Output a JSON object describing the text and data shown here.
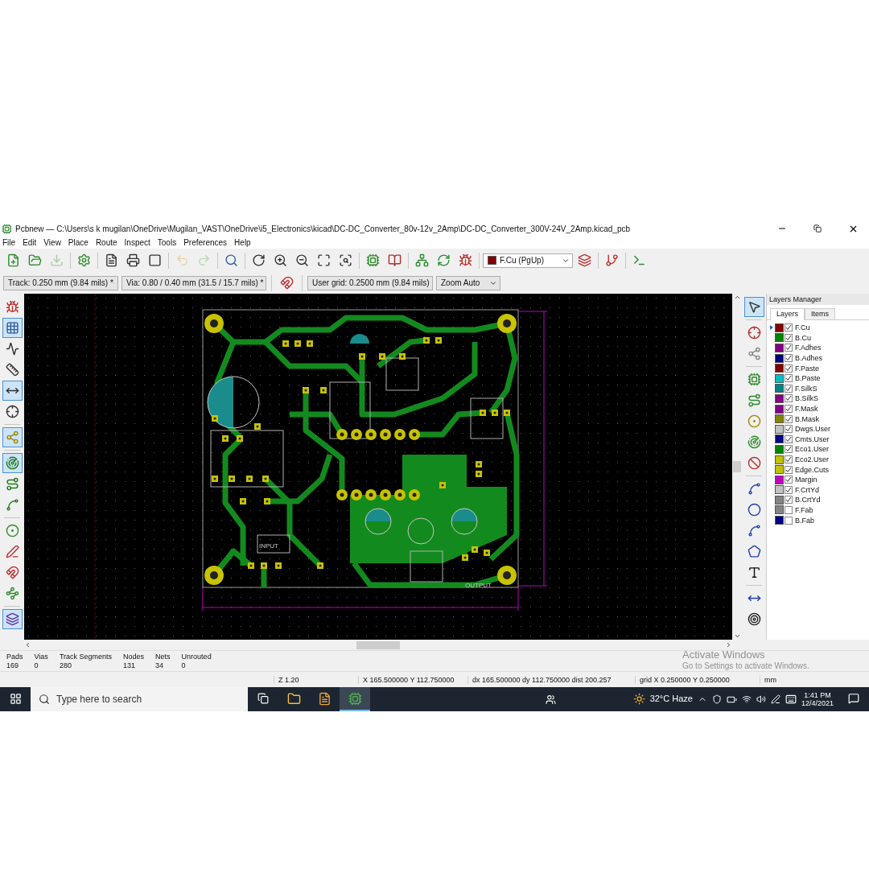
{
  "window": {
    "title": "Pcbnew — C:\\Users\\s k mugilan\\OneDrive\\Mugilan_VAST\\OneDrive\\i5_Electronics\\kicad\\DC-DC_Converter_80v-12v_2Amp\\DC-DC_Converter_300V-24V_2Amp.kicad_pcb"
  },
  "menu": [
    "File",
    "Edit",
    "View",
    "Place",
    "Route",
    "Inspect",
    "Tools",
    "Preferences",
    "Help"
  ],
  "main_toolbar": {
    "tools": [
      {
        "disabled": false
      },
      {
        "disabled": false
      },
      {
        "disabled": true
      },
      {
        "disabled": false
      },
      {
        "disabled": false
      },
      {
        "disabled": false
      },
      {
        "disabled": false
      },
      {
        "disabled": true
      },
      {
        "disabled": true
      },
      {
        "disabled": false
      },
      {
        "disabled": false
      },
      {
        "disabled": false
      },
      {
        "disabled": false
      },
      {
        "disabled": false
      },
      {
        "disabled": false
      },
      {
        "disabled": false
      },
      {
        "disabled": false
      },
      {
        "disabled": false
      },
      {
        "disabled": false
      },
      {
        "disabled": false
      }
    ],
    "layer_select": {
      "value": "F.Cu (PgUp)",
      "color": "#840000"
    },
    "tools_after": [
      {
        "disabled": false
      },
      {
        "disabled": false
      },
      {
        "disabled": false
      }
    ]
  },
  "options_toolbar": {
    "track": "Track: 0.250 mm (9.84 mils) *",
    "via": "Via: 0.80 / 0.40 mm (31.5 / 15.7 mils) *",
    "grid": "User grid: 0.2500 mm (9.84 mils)",
    "zoom": "Zoom Auto"
  },
  "left_toolbar": [
    {
      "selected": false
    },
    {
      "selected": true
    },
    {
      "selected": false
    },
    {
      "selected": false
    },
    {
      "selected": true
    },
    {
      "selected": false
    },
    {
      "selected": true
    },
    {
      "selected": true
    },
    {
      "selected": false
    },
    {
      "selected": false
    },
    {
      "selected": false
    },
    {
      "selected": false
    },
    {
      "selected": false
    },
    {
      "selected": false
    },
    {
      "selected": true
    }
  ],
  "right_toolbar": [
    {
      "selected": true
    },
    {
      "selected": false
    },
    {
      "selected": false
    },
    {
      "selected": false
    },
    {
      "selected": false
    },
    {
      "selected": false
    },
    {
      "selected": false
    },
    {
      "selected": false
    },
    {
      "selected": false
    },
    {
      "selected": false
    },
    {
      "selected": false
    },
    {
      "selected": false
    },
    {
      "selected": false
    },
    {
      "selected": false
    },
    {
      "selected": false
    }
  ],
  "canvas": {
    "labels": [
      "INPUT",
      "OUTPUT"
    ]
  },
  "layers_manager": {
    "title": "Layers Manager",
    "tabs": [
      {
        "label": "Layers",
        "selected": true
      },
      {
        "label": "Items",
        "selected": false
      }
    ],
    "layers": [
      {
        "name": "F.Cu",
        "color": "#840000",
        "checked": true,
        "selected": true
      },
      {
        "name": "B.Cu",
        "color": "#008400",
        "checked": true,
        "selected": false
      },
      {
        "name": "F.Adhes",
        "color": "#840084",
        "checked": true,
        "selected": false
      },
      {
        "name": "B.Adhes",
        "color": "#000084",
        "checked": true,
        "selected": false
      },
      {
        "name": "F.Paste",
        "color": "#840000",
        "checked": true,
        "selected": false
      },
      {
        "name": "B.Paste",
        "color": "#00c2c2",
        "checked": true,
        "selected": false
      },
      {
        "name": "F.SilkS",
        "color": "#008484",
        "checked": true,
        "selected": false
      },
      {
        "name": "B.SilkS",
        "color": "#840084",
        "checked": true,
        "selected": false
      },
      {
        "name": "F.Mask",
        "color": "#840084",
        "checked": true,
        "selected": false
      },
      {
        "name": "B.Mask",
        "color": "#848400",
        "checked": true,
        "selected": false
      },
      {
        "name": "Dwgs.User",
        "color": "#c2c2c2",
        "checked": true,
        "selected": false
      },
      {
        "name": "Cmts.User",
        "color": "#000084",
        "checked": true,
        "selected": false
      },
      {
        "name": "Eco1.User",
        "color": "#008400",
        "checked": true,
        "selected": false
      },
      {
        "name": "Eco2.User",
        "color": "#c2c200",
        "checked": true,
        "selected": false
      },
      {
        "name": "Edge.Cuts",
        "color": "#c2c200",
        "checked": true,
        "selected": false
      },
      {
        "name": "Margin",
        "color": "#c200c2",
        "checked": true,
        "selected": false
      },
      {
        "name": "F.CrtYd",
        "color": "#c2c2c2",
        "checked": true,
        "selected": false
      },
      {
        "name": "B.CrtYd",
        "color": "#848484",
        "checked": true,
        "selected": false
      },
      {
        "name": "F.Fab",
        "color": "#848484",
        "checked": false,
        "selected": false
      },
      {
        "name": "B.Fab",
        "color": "#000084",
        "checked": false,
        "selected": false
      }
    ]
  },
  "message_panel": [
    {
      "label": "Pads",
      "value": "169"
    },
    {
      "label": "Vias",
      "value": "0"
    },
    {
      "label": "Track Segments",
      "value": "280"
    },
    {
      "label": "Nodes",
      "value": "131"
    },
    {
      "label": "Nets",
      "value": "34"
    },
    {
      "label": "Unrouted",
      "value": "0"
    }
  ],
  "status_bar": [
    "Z 1.20",
    "X 165.500000  Y 112.750000",
    "dx 165.500000  dy 112.750000  dist 200.257",
    "grid X 0.250000  Y 0.250000",
    "mm"
  ],
  "activation_notice": {
    "title": "Activate Windows",
    "text": "Go to Settings to activate Windows."
  },
  "taskbar": {
    "search_placeholder": "Type here to search",
    "apps": [
      {
        "selected": false
      },
      {
        "selected": false
      },
      {
        "selected": true
      }
    ],
    "weather": "32°C  Haze",
    "time": "1:41 PM",
    "date": "12/4/2021"
  }
}
